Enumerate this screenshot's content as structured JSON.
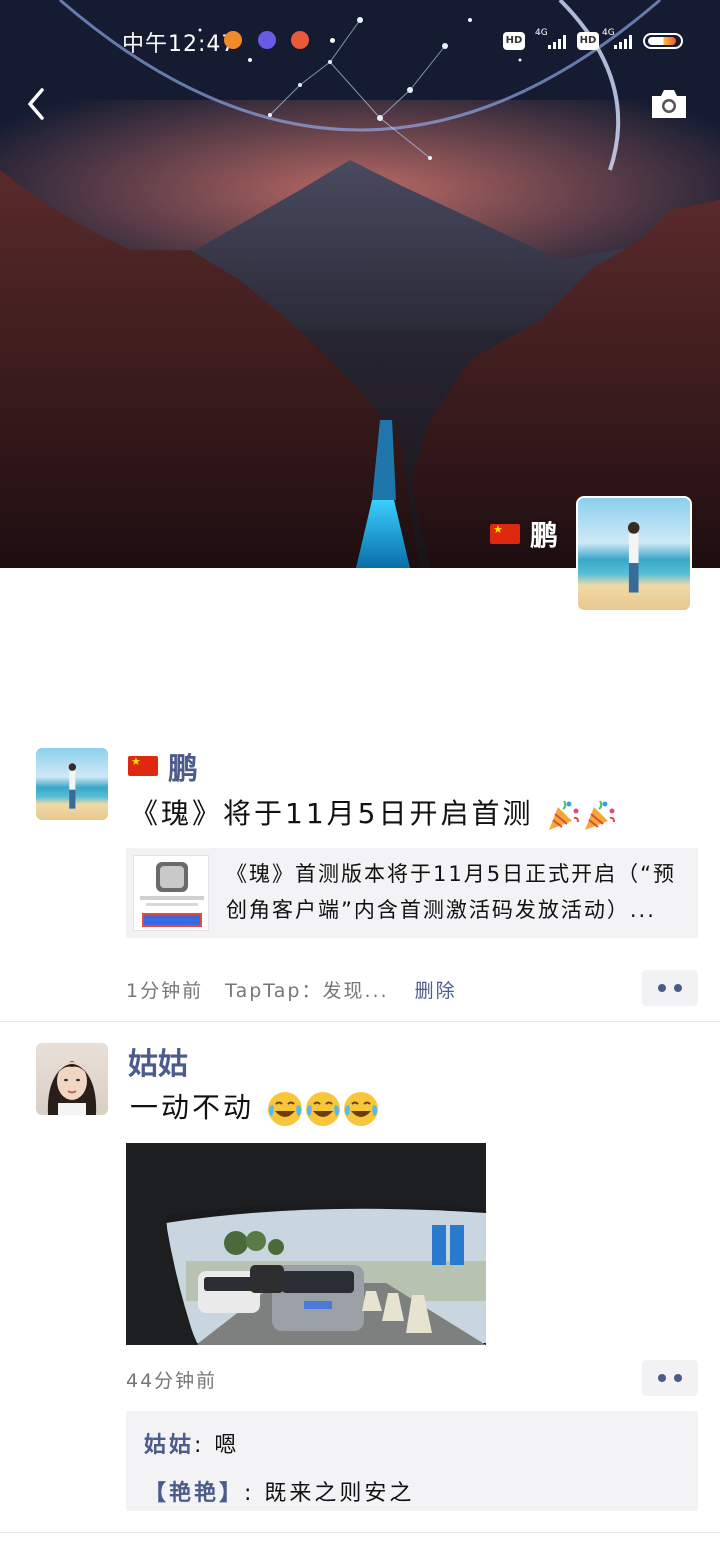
{
  "status_bar": {
    "time": "中午12:47",
    "network_1": "4G",
    "network_2": "4G",
    "hd_1": "HD",
    "hd_2": "HD"
  },
  "header": {
    "back_icon": "chevron-left-icon",
    "camera_icon": "camera-icon"
  },
  "profile": {
    "name": "鹏",
    "flag_icon": "china-flag-icon"
  },
  "posts": [
    {
      "author": "鹏",
      "text": "《瑰》将于11月5日开启首测",
      "emoji": "party-popper-icon",
      "link_card": {
        "line1": "《瑰》首测版本将于11月5日正式开启（“预",
        "line2": "创角客户端”内含首测激活码发放活动）..."
      },
      "time": "1分钟前",
      "source": "TapTap：发现...",
      "delete_label": "删除"
    },
    {
      "author": "姑姑",
      "text": "一动不动",
      "emoji": "crying-laughing-icon",
      "time": "44分钟前",
      "comments": [
        {
          "name": "姑姑",
          "sep": ": ",
          "text": "嗯"
        },
        {
          "name": "【艳艳】",
          "sep": ": ",
          "text": "既来之则安之"
        }
      ]
    }
  ],
  "colors": {
    "link_blue": "#4b5b8c",
    "card_bg": "#f3f3f5",
    "meta_gray": "#777777"
  }
}
